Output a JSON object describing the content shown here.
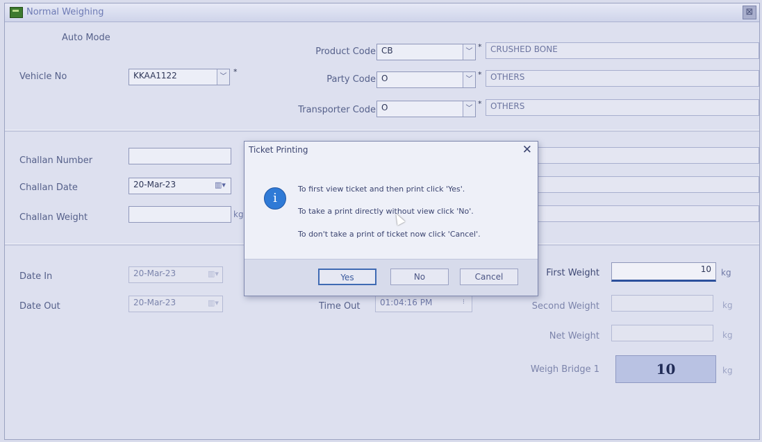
{
  "window": {
    "title": "Normal Weighing",
    "close_glyph": "⊠"
  },
  "mode": "Auto Mode",
  "vehicle": {
    "label": "Vehicle No",
    "value": "KKAA1122"
  },
  "product": {
    "label": "Product Code",
    "code": "CB",
    "name": "CRUSHED BONE"
  },
  "party": {
    "label": "Party Code",
    "code": "O",
    "name": "OTHERS"
  },
  "transporter": {
    "label": "Transporter Code",
    "code": "O",
    "name": "OTHERS"
  },
  "required_mark": "*",
  "challan": {
    "number_label": "Challan Number",
    "date_label": "Challan Date",
    "date_value": "20-Mar-23",
    "weight_label": "Challan Weight",
    "weight_unit": "kg"
  },
  "date_in": {
    "label": "Date In",
    "value": "20-Mar-23"
  },
  "date_out": {
    "label": "Date Out",
    "value": "20-Mar-23"
  },
  "time_out": {
    "label": "Time Out",
    "value": "01:04:16 PM"
  },
  "weights": {
    "first_label": "First Weight",
    "first_value": "10",
    "second_label": "Second Weight",
    "second_value": "",
    "net_label": "Net Weight",
    "net_value": "",
    "bridge_label": "Weigh Bridge 1",
    "bridge_value": "10",
    "unit": "kg"
  },
  "dialog": {
    "title": "Ticket Printing",
    "close_glyph": "✕",
    "info_glyph": "i",
    "messages": [
      "To first view ticket and then print click 'Yes'.",
      "To take a print directly without view click 'No'.",
      "To don't take a print of ticket now click 'Cancel'."
    ],
    "buttons": {
      "yes": "Yes",
      "no": "No",
      "cancel": "Cancel"
    }
  },
  "icons": {
    "dropdown": "chevron-down-icon",
    "calendar": "calendar-icon",
    "spinner": "spinner-icon",
    "info": "info-icon"
  }
}
